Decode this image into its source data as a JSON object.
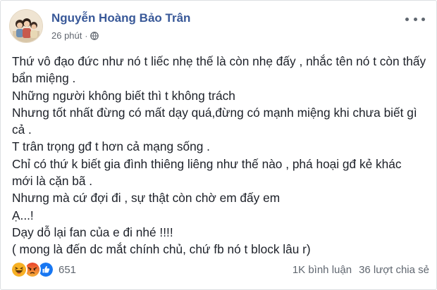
{
  "post": {
    "author": "Nguyễn Hoàng Bảo Trân",
    "time": "26 phút",
    "time_separator": "·",
    "privacy_icon": "globe-icon",
    "lines": [
      "Thứ vô đạo đức như nó t liếc nhẹ thế là còn nhẹ đấy , nhắc tên nó t còn thấy",
      "bẩn miệng .",
      "Những người không biết thì t không trách",
      "Nhưng tốt nhất đừng có mất dạy quá,đừng có mạnh miệng khi chưa biết gì",
      "cả .",
      "T trân trọng gđ t hơn cả mạng sống .",
      "Chỉ có thứ k biết gia đình thiêng liêng như thế nào , phá hoại gđ kẻ khác",
      "mới là cặn bã .",
      "Nhưng mà cứ đợi đi , sự thật còn chờ em đấy em",
      "Ạ...!",
      "Dạy dỗ lại fan của e đi nhé !!!!",
      "( mong là đến dc mắt chính chủ, chứ fb nó t block lâu r)"
    ]
  },
  "reactions": {
    "icons": [
      "haha-icon",
      "angry-icon",
      "like-icon"
    ],
    "count": "651"
  },
  "stats": {
    "comments": "1K bình luận",
    "shares": "36 lượt chia sẻ"
  },
  "colors": {
    "author": "#385898",
    "meta": "#616770",
    "like": "#1877f2",
    "haha": "#f7b125",
    "angry": "#e9710f"
  }
}
